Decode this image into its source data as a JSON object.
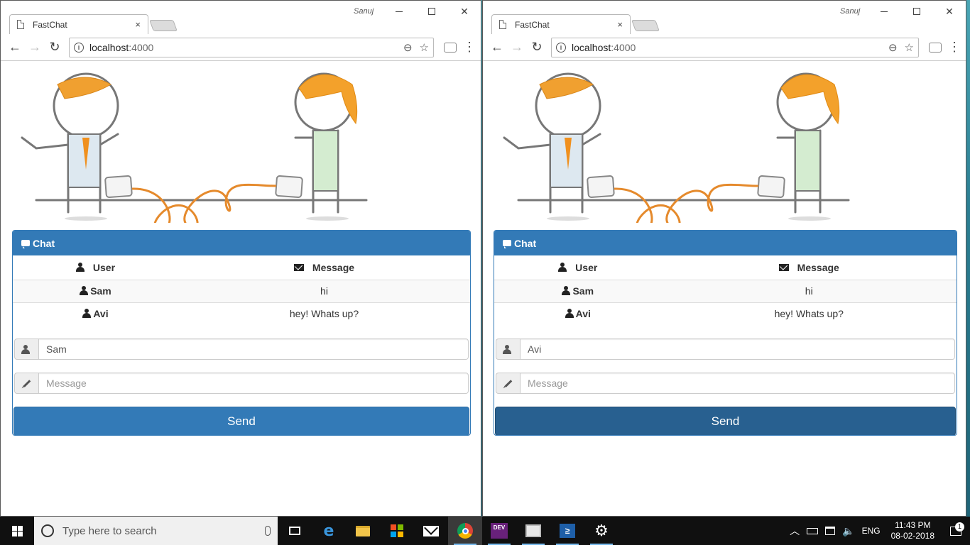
{
  "windows": [
    {
      "tab_title": "FastChat",
      "tab_close": "×",
      "user_label": "Sanuj",
      "url_host": "localhost",
      "url_port": ":4000",
      "panel_title": "Chat",
      "columns": {
        "user": "User",
        "message": "Message"
      },
      "rows": [
        {
          "user": "Sam",
          "message": "hi"
        },
        {
          "user": "Avi",
          "message": "hey! Whats up?"
        }
      ],
      "username_value": "Sam",
      "message_placeholder": "Message",
      "send_label": "Send",
      "send_pressed": false
    },
    {
      "tab_title": "FastChat",
      "tab_close": "×",
      "user_label": "Sanuj",
      "url_host": "localhost",
      "url_port": ":4000",
      "panel_title": "Chat",
      "columns": {
        "user": "User",
        "message": "Message"
      },
      "rows": [
        {
          "user": "Sam",
          "message": "hi"
        },
        {
          "user": "Avi",
          "message": "hey! Whats up?"
        }
      ],
      "username_value": "Avi",
      "message_placeholder": "Message",
      "send_label": "Send",
      "send_pressed": true
    }
  ],
  "colors": {
    "primary": "#337ab7",
    "primary_pressed": "#286090",
    "taskbar": "#101010"
  },
  "taskbar": {
    "search_placeholder": "Type here to search",
    "devenv_label": "DEV",
    "powershell_glyph": "≥",
    "language": "ENG",
    "time": "11:43 PM",
    "date": "08-02-2018",
    "notification_count": "1",
    "pinned_apps": [
      "task-view",
      "edge",
      "file-explorer",
      "store",
      "mail",
      "chrome",
      "visual-studio",
      "sheet",
      "powershell",
      "settings"
    ]
  }
}
